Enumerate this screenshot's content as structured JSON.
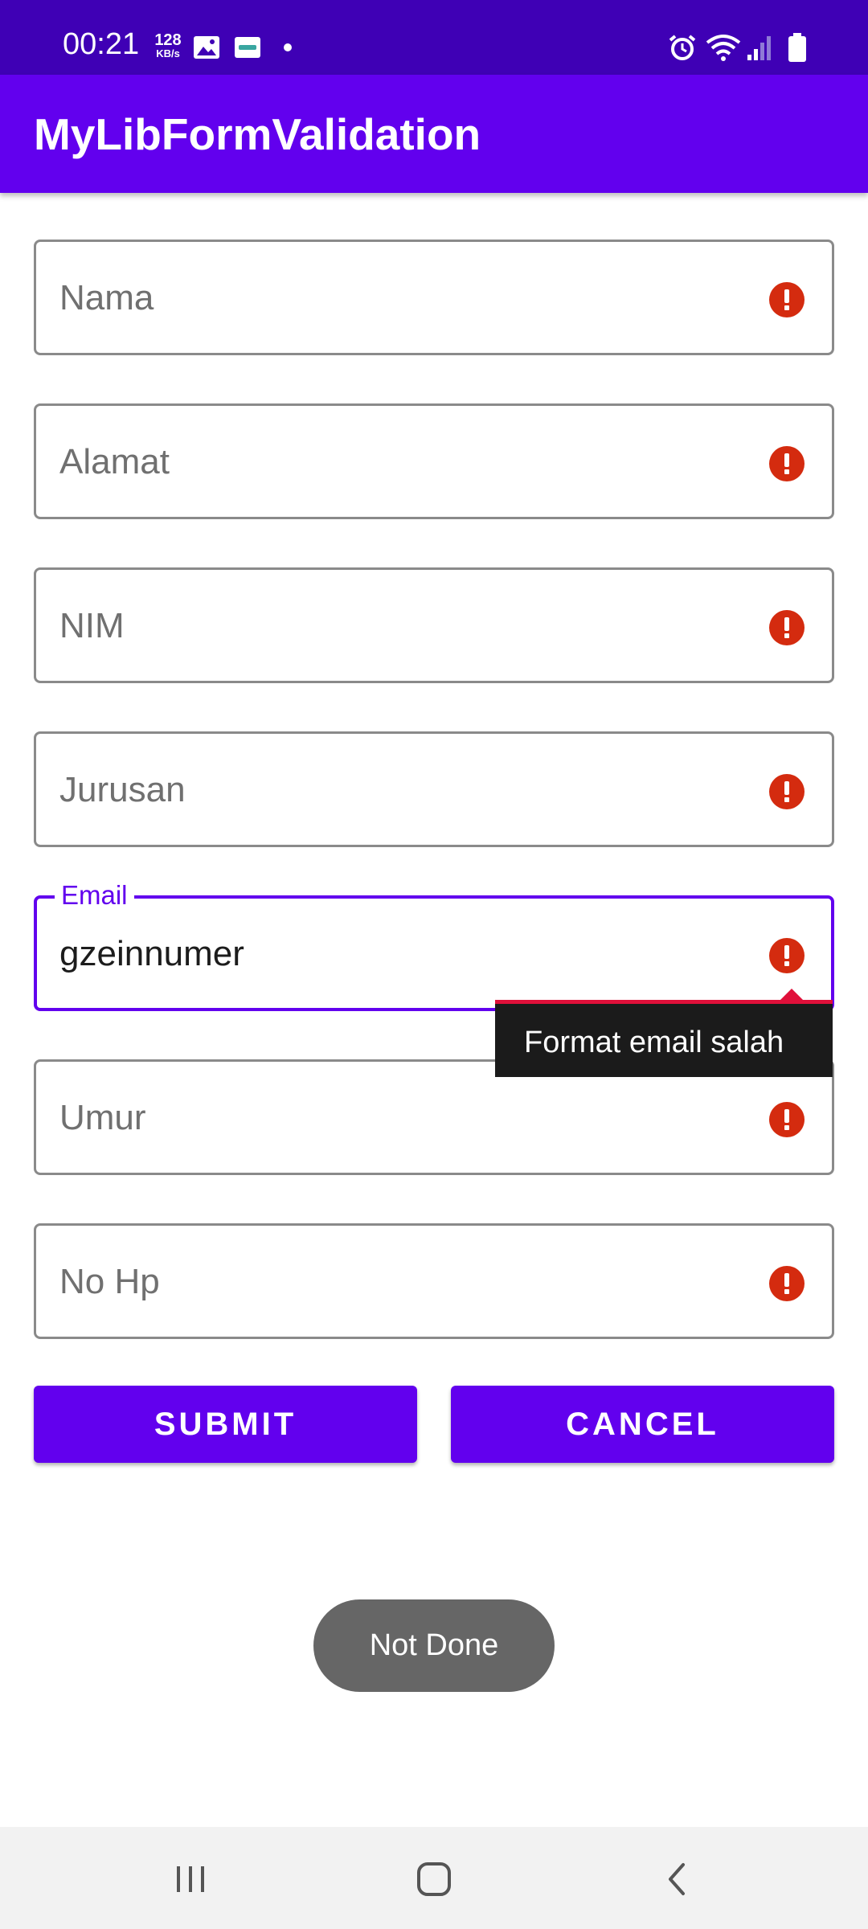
{
  "status_bar": {
    "time": "00:21",
    "net_speed": "128",
    "net_unit": "KB/s",
    "icons": [
      "gallery-icon",
      "app-notification-icon",
      "notification-dot",
      "alarm-icon",
      "wifi-icon",
      "cell-signal-icon",
      "battery-icon"
    ]
  },
  "app_bar": {
    "title": "MyLibFormValidation"
  },
  "form": {
    "fields": [
      {
        "name": "nama",
        "placeholder": "Nama",
        "value": "",
        "error": true
      },
      {
        "name": "alamat",
        "placeholder": "Alamat",
        "value": "",
        "error": true
      },
      {
        "name": "nim",
        "placeholder": "NIM",
        "value": "",
        "error": true
      },
      {
        "name": "jurusan",
        "placeholder": "Jurusan",
        "value": "",
        "error": true
      },
      {
        "name": "email",
        "label": "Email",
        "value": "gzeinnumer",
        "error": true,
        "focused": true
      },
      {
        "name": "umur",
        "placeholder": "Umur",
        "value": "",
        "error": true
      },
      {
        "name": "no_hp",
        "placeholder": "No Hp",
        "value": "",
        "error": true
      }
    ],
    "email_error": "Format email salah"
  },
  "buttons": {
    "submit": "SUBMIT",
    "cancel": "CANCEL"
  },
  "toast": "Not Done",
  "colors": {
    "status_bar": "#3f00b5",
    "primary": "#6200ee",
    "error_icon": "#d42b0f",
    "tooltip_accent": "#e0103a",
    "toast": "#666666"
  },
  "nav_bar": {
    "icons": [
      "recents-icon",
      "home-icon",
      "back-icon"
    ]
  }
}
